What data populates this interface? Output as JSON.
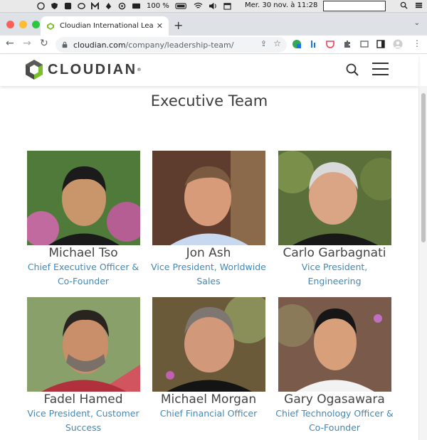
{
  "menubar": {
    "battery": "100 %",
    "datetime": "Mer. 30 nov. à  11:28"
  },
  "browser": {
    "tab_title": "Cloudian International Leadersh",
    "url_host": "cloudian.com",
    "url_path": "/company/leadership-team/"
  },
  "site": {
    "logo_text": "CLOUDIAN",
    "accent": "#3f89b8"
  },
  "page": {
    "section_title": "Executive Team",
    "members": [
      {
        "name": "Michael Tso",
        "role_line1": "Chief Executive Officer &",
        "role_line2": "Co-Founder"
      },
      {
        "name": "Jon Ash",
        "role_line1": "Vice President, Worldwide",
        "role_line2": "Sales"
      },
      {
        "name": "Carlo Garbagnati",
        "role_line1": "Vice President,",
        "role_line2": "Engineering"
      },
      {
        "name": "Fadel Hamed",
        "role_line1": "Vice President, Customer",
        "role_line2": "Success"
      },
      {
        "name": "Michael Morgan",
        "role_line1": "Chief Financial Officer",
        "role_line2": ""
      },
      {
        "name": "Gary Ogasawara",
        "role_line1": "Chief Technology Officer &",
        "role_line2": "Co-Founder"
      }
    ]
  }
}
